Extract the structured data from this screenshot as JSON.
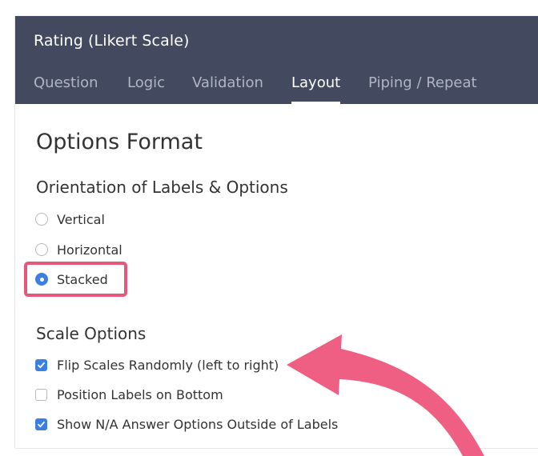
{
  "header": {
    "title": "Rating (Likert Scale)",
    "tabs": [
      {
        "label": "Question",
        "active": false
      },
      {
        "label": "Logic",
        "active": false
      },
      {
        "label": "Validation",
        "active": false
      },
      {
        "label": "Layout",
        "active": true
      },
      {
        "label": "Piping / Repeat",
        "active": false
      }
    ]
  },
  "main": {
    "heading": "Options Format",
    "orientation": {
      "heading": "Orientation of Labels & Options",
      "options": [
        {
          "label": "Vertical",
          "checked": false
        },
        {
          "label": "Horizontal",
          "checked": false
        },
        {
          "label": "Stacked",
          "checked": true
        }
      ]
    },
    "scale": {
      "heading": "Scale Options",
      "options": [
        {
          "label": "Flip Scales Randomly (left to right)",
          "checked": true
        },
        {
          "label": "Position Labels on Bottom",
          "checked": false
        },
        {
          "label": "Show N/A Answer Options Outside of Labels",
          "checked": true
        }
      ]
    }
  },
  "colors": {
    "header_bg": "#434a60",
    "accent": "#3d7fe0",
    "annotation": "#e7577c"
  }
}
